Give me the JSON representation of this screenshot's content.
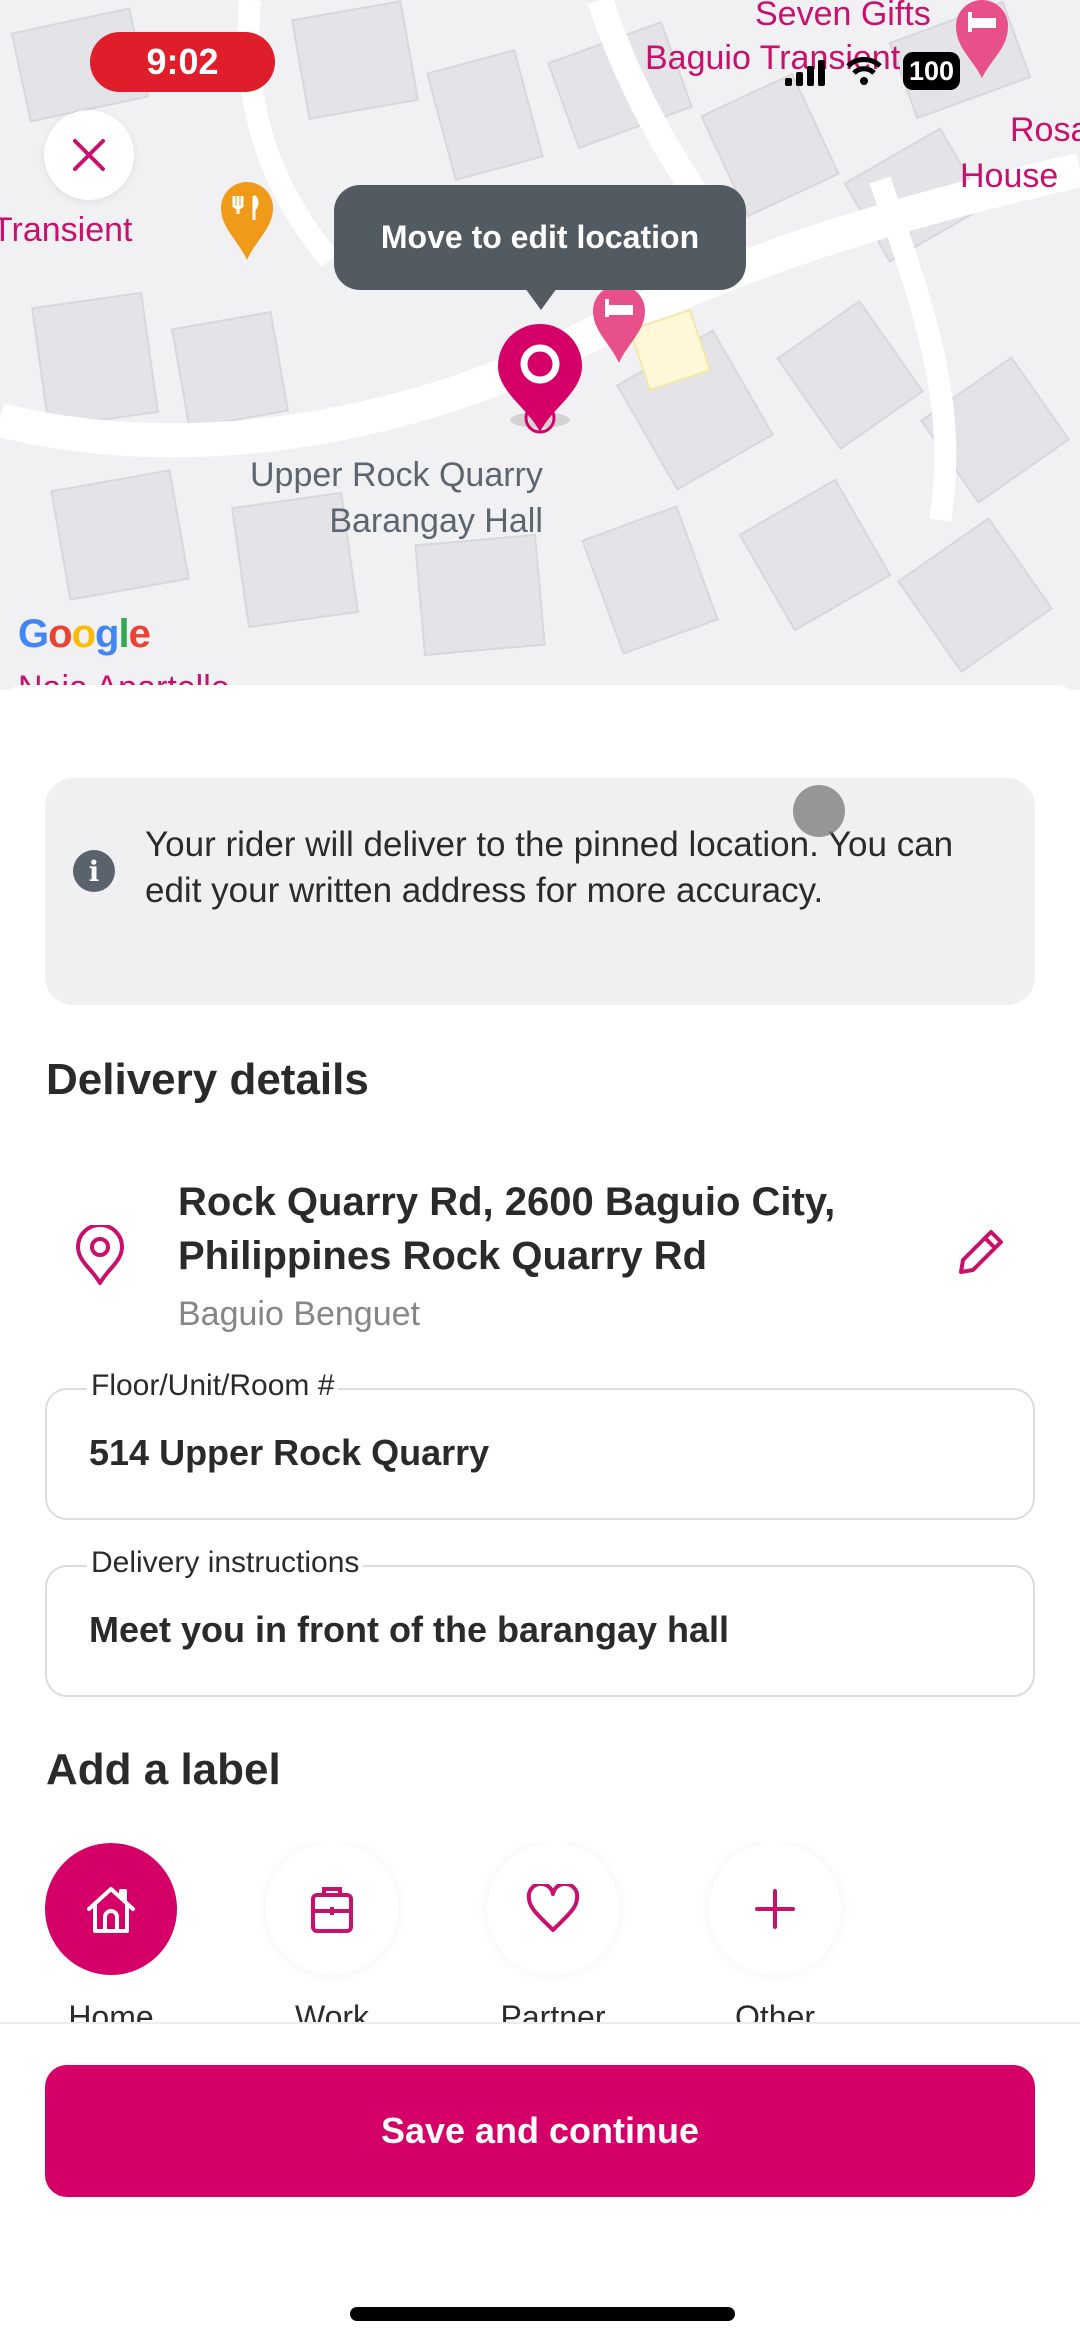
{
  "status_bar": {
    "time": "9:02",
    "battery": "100"
  },
  "map": {
    "tooltip": "Move to edit location",
    "place_label_line1": "Upper Rock Quarry",
    "place_label_line2": "Barangay Hall",
    "poi_labels": [
      "Seven Gifts",
      "Baguio Transient...",
      "Rosa",
      "House",
      "Transient",
      "Naja Apartelle"
    ],
    "attribution": [
      "G",
      "o",
      "o",
      "g",
      "l",
      "e"
    ],
    "accent_color": "#d40068"
  },
  "info": {
    "text": "Your rider will deliver to the pinned location. You can edit your written address for more accuracy."
  },
  "delivery": {
    "title": "Delivery details",
    "address_main": "Rock Quarry Rd, 2600 Baguio City, Philippines Rock Quarry Rd",
    "address_sub": "Baguio Benguet",
    "floor_label": "Floor/Unit/Room #",
    "floor_value": "514 Upper Rock Quarry",
    "instructions_label": "Delivery instructions",
    "instructions_value": "Meet you in front of the barangay hall"
  },
  "labels": {
    "title": "Add a label",
    "items": [
      {
        "label": "Home",
        "icon": "home-icon",
        "selected": true
      },
      {
        "label": "Work",
        "icon": "briefcase-icon",
        "selected": false
      },
      {
        "label": "Partner",
        "icon": "heart-icon",
        "selected": false
      },
      {
        "label": "Other",
        "icon": "plus-icon",
        "selected": false
      }
    ]
  },
  "actions": {
    "save_label": "Save and continue"
  }
}
